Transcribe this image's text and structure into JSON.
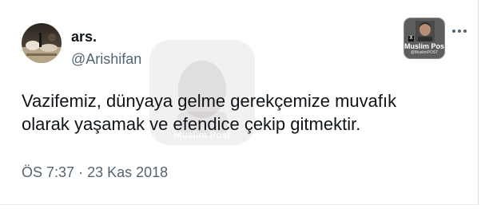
{
  "tweet": {
    "author": {
      "display_name": "ars.",
      "handle": "@Arishifan",
      "avatar_icon": "profile-photo"
    },
    "text_lines": [
      "Vazifemiz, dünyaya gelme gerekçemize muvafık",
      "olarak yaşamak ve efendice çekip gitmektir."
    ],
    "time": "ÖS 7:37",
    "separator": "·",
    "date": "23 Kas 2018",
    "more_icon": "more-horizontal-icon"
  },
  "watermark_badge": {
    "title": "Muslim Post",
    "subtitle": "@MuslimPOST",
    "x_mark": "X"
  },
  "center_watermark": {
    "label": "Muslim Post"
  },
  "colors": {
    "text_primary": "#0f1419",
    "text_secondary": "#536471",
    "badge_bg": "#5e5e5e"
  }
}
